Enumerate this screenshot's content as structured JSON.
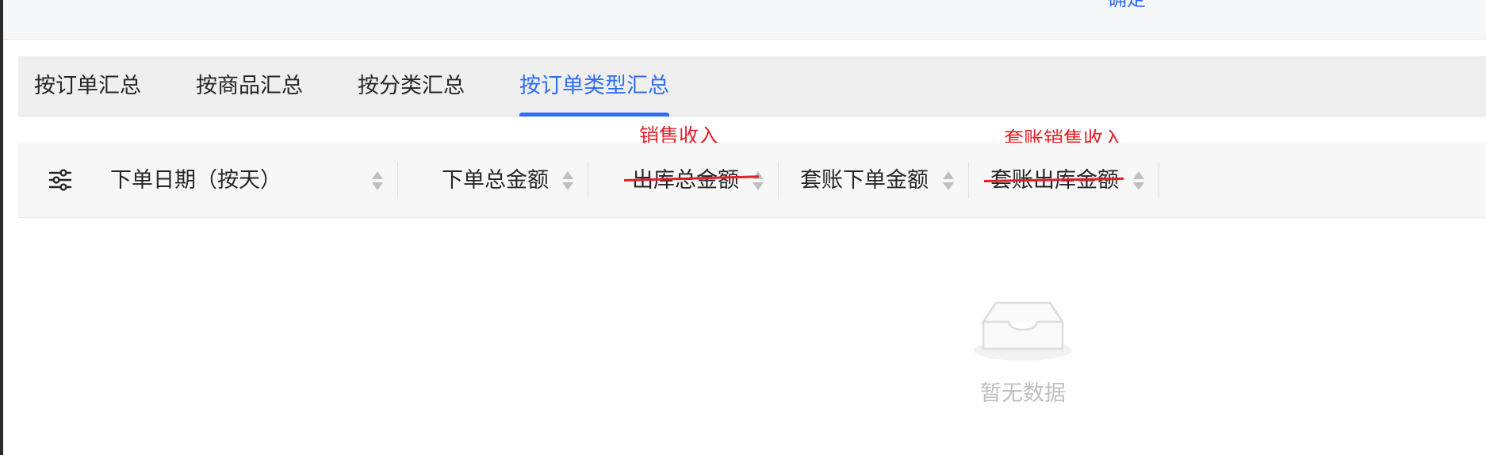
{
  "top": {
    "link_label": "确定"
  },
  "tabs": [
    {
      "label": "按订单汇总"
    },
    {
      "label": "按商品汇总"
    },
    {
      "label": "按分类汇总"
    },
    {
      "label": "按订单类型汇总",
      "active": true
    }
  ],
  "table": {
    "columns": [
      {
        "label": "下单日期（按天）",
        "struck": false
      },
      {
        "label": "下单总金额",
        "struck": false
      },
      {
        "label": "出库总金额",
        "struck": true,
        "annotation": "销售收入"
      },
      {
        "label": "套账下单金额",
        "struck": false
      },
      {
        "label": "套账出库金额",
        "struck": true,
        "annotation": "套账销售收入"
      }
    ],
    "empty_text": "暂无数据"
  },
  "colors": {
    "accent": "#2f6ef2",
    "annotation": "#e0202a",
    "muted": "#bfbfbf"
  }
}
